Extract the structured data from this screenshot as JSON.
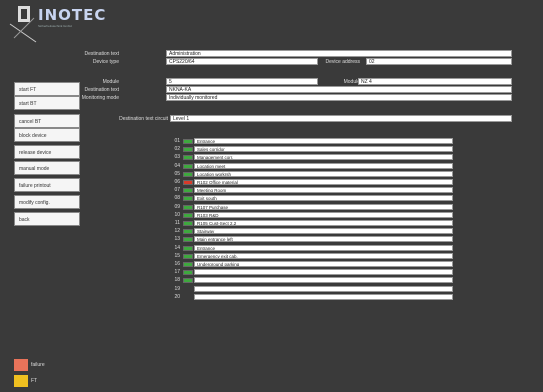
{
  "logo": {
    "brand": "INOTEC",
    "tagline": "Sicherheitstechnik GmbH"
  },
  "header": {
    "destination_text_label": "Destination text",
    "destination_text_value": "Administration",
    "device_type_label": "Device type",
    "device_type_value": "CPS220/64",
    "device_address_label": "Device address",
    "device_address_value": "02"
  },
  "module": {
    "module_label": "Module",
    "module_value": "5",
    "module_type_label": "Module",
    "module_type_value": "NZ 4",
    "destination_text_label": "Destination text",
    "destination_text_value": "NKNA-KA",
    "monitoring_mode_label": "Monitoring mode",
    "monitoring_mode_value": "Individually monitored",
    "circuit_label": "Destination text circuit",
    "circuit_value": "Level 1"
  },
  "sidebar": {
    "buttons": [
      "start FT",
      "start BT",
      "cancel BT",
      "block device",
      "release device",
      "manual mode",
      "failure printout",
      "modify config.",
      "back"
    ]
  },
  "colors": {
    "green": "#3ea83e",
    "red": "#d83a2a",
    "legend_red": "#e8735a",
    "legend_yellow": "#f0c020"
  },
  "rows": [
    {
      "num": "01",
      "status": "green",
      "text": "Entrance"
    },
    {
      "num": "02",
      "status": "green",
      "text": "Sales corridor"
    },
    {
      "num": "03",
      "status": "green",
      "text": "Management corr."
    },
    {
      "num": "04",
      "status": "green",
      "text": "Location meet"
    },
    {
      "num": "05",
      "status": "green",
      "text": "Location workrsh"
    },
    {
      "num": "06",
      "status": "red",
      "text": "R102 Office material"
    },
    {
      "num": "07",
      "status": "green",
      "text": "Meeting Room"
    },
    {
      "num": "08",
      "status": "green",
      "text": "Exit south"
    },
    {
      "num": "09",
      "status": "green",
      "text": "R107 Purchase"
    },
    {
      "num": "10",
      "status": "green",
      "text": "R103 R&D"
    },
    {
      "num": "11",
      "status": "green",
      "text": "R105 Cust-Sect 2.2"
    },
    {
      "num": "12",
      "status": "green",
      "text": "Stairway"
    },
    {
      "num": "13",
      "status": "green",
      "text": "Main entrance left"
    },
    {
      "num": "14",
      "status": "green",
      "text": "Entrance"
    },
    {
      "num": "15",
      "status": "green",
      "text": "Emergency exit cab."
    },
    {
      "num": "16",
      "status": "green",
      "text": "Underground parking"
    },
    {
      "num": "17",
      "status": "green",
      "text": ""
    },
    {
      "num": "18",
      "status": "green",
      "text": ""
    },
    {
      "num": "19",
      "status": "none",
      "text": ""
    },
    {
      "num": "20",
      "status": "none",
      "text": ""
    }
  ],
  "legend": [
    {
      "label": "failure",
      "color": "legend_red"
    },
    {
      "label": "FT",
      "color": "legend_yellow"
    }
  ]
}
